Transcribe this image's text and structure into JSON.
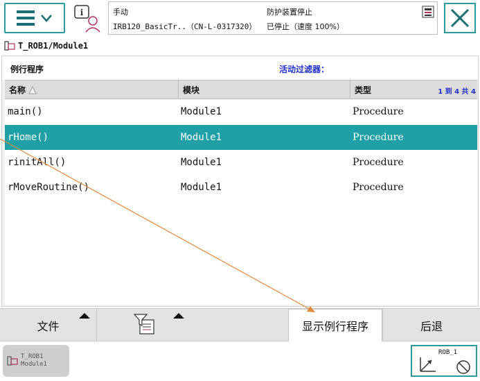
{
  "header": {
    "mode": "手动",
    "controller": "IRB120_BasicTr..（CN-L-0317320）",
    "guard_status": "防护装置停止",
    "run_status": "已停止（速度 100%）"
  },
  "breadcrumb": "T_ROB1/Module1",
  "panel": {
    "title": "例行程序",
    "filter_label": "活动过滤器：",
    "columns": [
      "名称",
      "模块",
      "类型"
    ],
    "pager": "1 到 4 共 4",
    "rows": [
      {
        "name": "main()",
        "module": "Module1",
        "type": "Procedure",
        "selected": false
      },
      {
        "name": "rHome()",
        "module": "Module1",
        "type": "Procedure",
        "selected": true
      },
      {
        "name": "rinitAll()",
        "module": "Module1",
        "type": "Procedure",
        "selected": false
      },
      {
        "name": "rMoveRoutine()",
        "module": "Module1",
        "type": "Procedure",
        "selected": false
      }
    ]
  },
  "commands": {
    "file": "文件",
    "show_routine": "显示例行程序",
    "back": "后退"
  },
  "taskbar": {
    "task_line1": "T_ROB1",
    "task_line2": "Module1",
    "robot": "ROB_1"
  },
  "colors": {
    "accent": "#2a9a9a",
    "selected_row": "#1f9fa6",
    "filter_text": "#1f2fcf",
    "annotation_arrow": "#e08a3c"
  },
  "icons": [
    "menu-icon",
    "chevron-down-icon",
    "info-user-icon",
    "run-status-icon",
    "close-icon",
    "routine-icon",
    "sort-up-icon",
    "filter-icon",
    "jog-axes-icon",
    "no-entry-icon"
  ]
}
